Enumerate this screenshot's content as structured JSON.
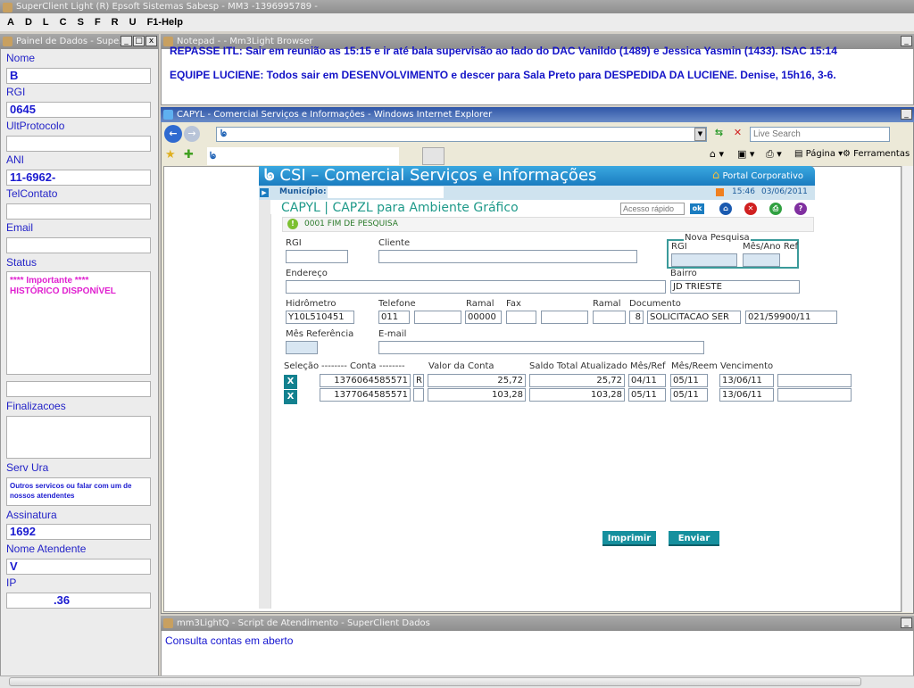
{
  "app": {
    "title": "SuperClient Light (R) Epsoft Sistemas    Sabesp - MM3 -1396995789 -",
    "menu": [
      "A",
      "D",
      "L",
      "C",
      "S",
      "F",
      "R",
      "U",
      "F1-Help"
    ]
  },
  "panel": {
    "title": "Painel de Dados - Supe...",
    "fields": [
      {
        "label": "Nome",
        "value": "B"
      },
      {
        "label": "RGI",
        "value": "0645"
      },
      {
        "label": "UltProtocolo",
        "value": ""
      },
      {
        "label": "ANI",
        "value": "11-6962-"
      },
      {
        "label": "TelContato",
        "value": ""
      },
      {
        "label": "Email",
        "value": ""
      }
    ],
    "status_label": "Status",
    "status_lines": [
      "**** Importante ****",
      "HISTÓRICO DISPONÍVEL"
    ],
    "finalizacoes_label": "Finalizacoes",
    "serv_ura_label": "Serv Ura",
    "serv_ura_text": "Outros servicos ou falar com um de nossos atendentes",
    "assinatura_label": "Assinatura",
    "assinatura": "1692",
    "nome_atendente_label": "Nome Atendente",
    "nome_atendente": "V",
    "ip_label": "IP",
    "ip": ".36"
  },
  "notepad": {
    "title": "Notepad -  - Mm3Light Browser",
    "lines": [
      "REPASSE ITL: Sair em reunião as 15:15 e ir até bala supervisão ao lado do DAC Vanildo (1489) e Jessica Yasmin (1433). ISAC 15:14",
      "EQUIPE LUCIENE: Todos sair em DESENVOLVIMENTO e descer para Sala Preto para DESPEDIDA DA LUCIENE. Denise, 15h16, 3-6."
    ]
  },
  "ie": {
    "title": "CAPYL - Comercial Serviços e Informações - Windows Internet Explorer",
    "search_placeholder": "Live Search",
    "pagina": "Página",
    "ferramentas": "Ferramentas"
  },
  "csi": {
    "header": "CSI – Comercial Serviços e Informações",
    "portal": "Portal Corporativo",
    "municipio_label": "Município:",
    "time": "15:46",
    "date": "03/06/2011",
    "screen_title": "CAPYL | CAPZL para Ambiente Gráfico",
    "quick_placeholder": "Acesso rápido",
    "ok": "ok",
    "message": "0001 FIM DE PESQUISA",
    "labels": {
      "rgi": "RGI",
      "cliente": "Cliente",
      "nova": "Nova Pesquisa",
      "nrgi": "RGI",
      "mesano": "Mês/Ano Ref",
      "endereco": "Endereço",
      "bairro": "Bairro",
      "hidrometro": "Hidrômetro",
      "telefone": "Telefone",
      "ramal": "Ramal",
      "fax": "Fax",
      "ramal2": "Ramal",
      "documento": "Documento",
      "mesref": "Mês Referência",
      "email": "E-mail"
    },
    "values": {
      "bairro": "JD TRIESTE",
      "hidrometro": "Y10L510451",
      "ddd": "011",
      "ramal": "00000",
      "doc_digit": "8",
      "doc_type": "SOLICITACAO SER",
      "doc_num": "021/59900/11"
    },
    "table_headers": [
      "Seleção",
      "-------- Conta --------",
      "Valor da Conta",
      "Saldo Total Atualizado",
      "Mês/Ref",
      "Mês/Reem",
      "Vencimento"
    ],
    "rows": [
      {
        "sel": "X",
        "conta": "1376064585571",
        "flag": "R",
        "valor": "25,72",
        "saldo": "25,72",
        "mesref": "04/11",
        "mesreem": "05/11",
        "venc": "13/06/11"
      },
      {
        "sel": "X",
        "conta": "1377064585571",
        "flag": "",
        "valor": "103,28",
        "saldo": "103,28",
        "mesref": "05/11",
        "mesreem": "05/11",
        "venc": "13/06/11"
      }
    ],
    "imprimir": "Imprimir",
    "enviar": "Enviar"
  },
  "script": {
    "title": "mm3LightQ - Script de Atendimento - SuperClient Dados",
    "text": "Consulta contas em aberto"
  }
}
